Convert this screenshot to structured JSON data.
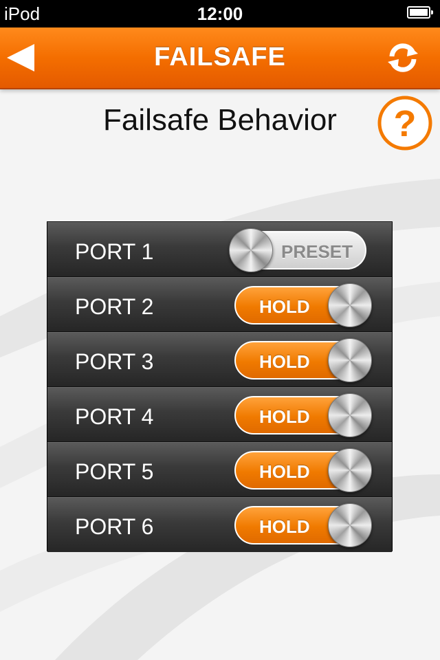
{
  "status_bar": {
    "carrier": "iPod",
    "time": "12:00"
  },
  "nav_bar": {
    "title": "FAILSAFE"
  },
  "page": {
    "title": "Failsafe Behavior",
    "help_symbol": "?"
  },
  "icons": {
    "back": "back-arrow-icon",
    "refresh": "refresh-icon",
    "help": "help-icon",
    "battery": "battery-icon"
  },
  "colors": {
    "accent": "#f46e00",
    "toggle_on": "#f07a00"
  },
  "ports": [
    {
      "label": "PORT 1",
      "mode": "PRESET",
      "on": false
    },
    {
      "label": "PORT 2",
      "mode": "HOLD",
      "on": true
    },
    {
      "label": "PORT 3",
      "mode": "HOLD",
      "on": true
    },
    {
      "label": "PORT 4",
      "mode": "HOLD",
      "on": true
    },
    {
      "label": "PORT 5",
      "mode": "HOLD",
      "on": true
    },
    {
      "label": "PORT 6",
      "mode": "HOLD",
      "on": true
    }
  ]
}
